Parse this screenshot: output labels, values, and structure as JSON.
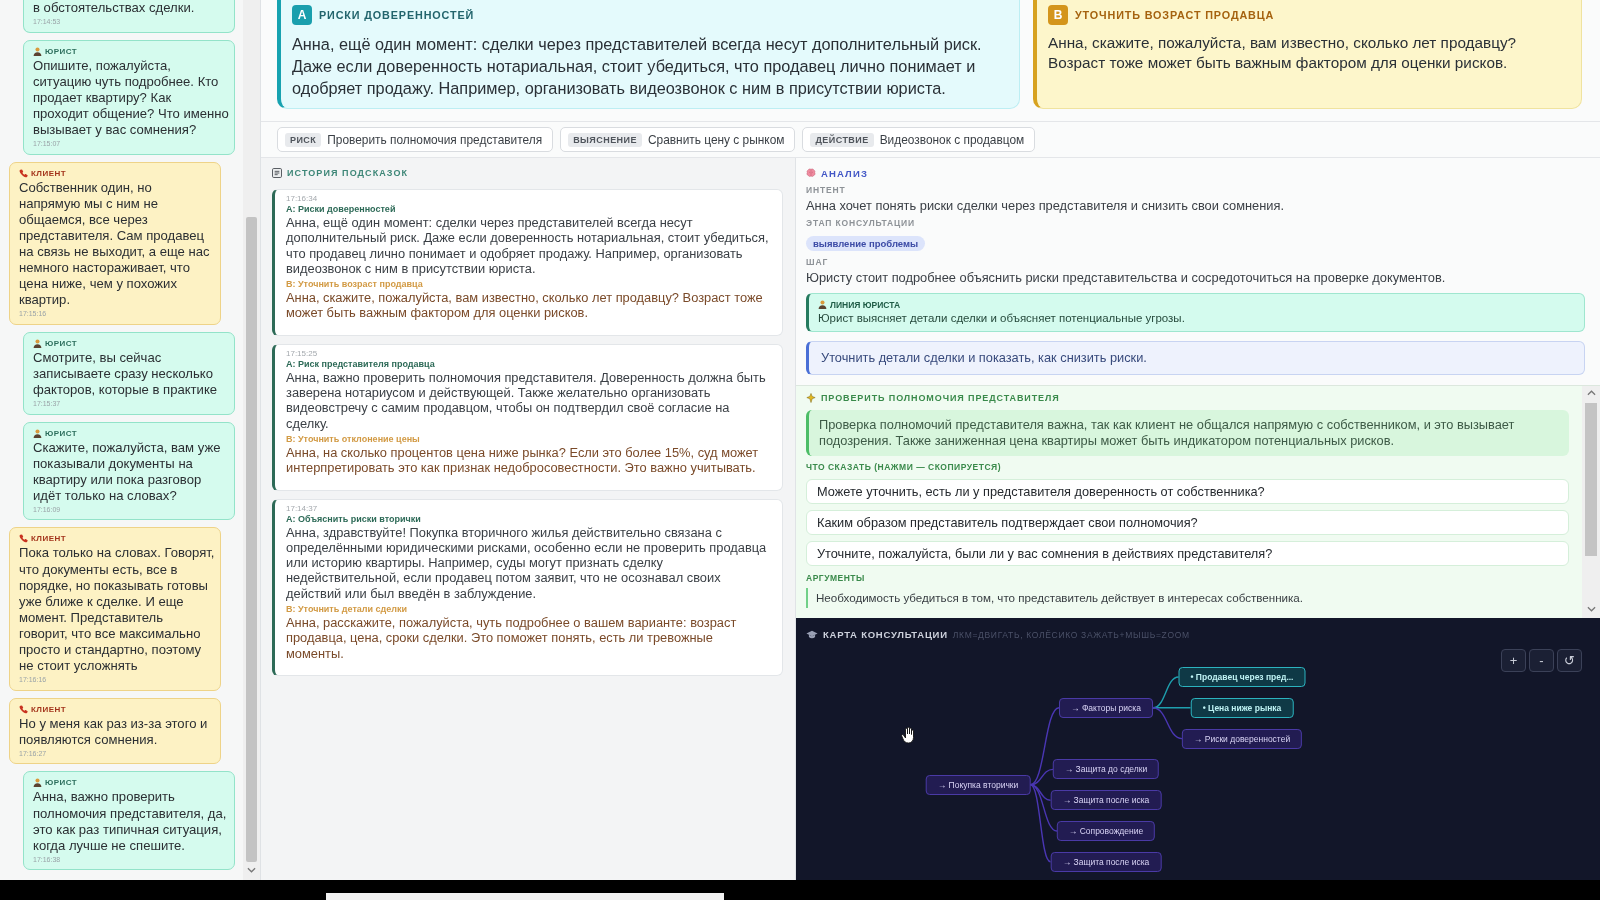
{
  "chat": {
    "messages": [
      {
        "kind": "lawyer",
        "text": "в обстоятельствах сделки.",
        "time": "17:14:53"
      },
      {
        "kind": "lawyer",
        "author": "ЮРИСТ",
        "text": "Опишите, пожалуйста, ситуацию чуть подробнее. Кто продает квартиру? Как проходит общение? Что именно вызывает у вас сомнения?",
        "time": "17:15:07"
      },
      {
        "kind": "client",
        "author": "КЛИЕНТ",
        "text": "Собственник один, но напрямую мы с ним не общаемся, все через представителя. Сам продавец на связь не выходит, а еще нас немного настораживает, что цена ниже, чем у похожих квартир.",
        "time": "17:15:16"
      },
      {
        "kind": "lawyer",
        "author": "ЮРИСТ",
        "text": "Смотрите, вы сейчас записываете сразу несколько факторов, которые в практике",
        "time": "17:15:37"
      },
      {
        "kind": "lawyer",
        "author": "ЮРИСТ",
        "text": "Скажите, пожалуйста, вам уже показывали документы на квартиру или пока разговор идёт только на словах?",
        "time": "17:16:09"
      },
      {
        "kind": "client",
        "author": "КЛИЕНТ",
        "text": "Пока только на словах. Говорят, что документы есть, все в порядке, но показывать готовы уже ближе к сделке. И еще момент. Представитель говорит, что все максимально просто и стандартно, поэтому не стоит усложнять",
        "time": "17:16:16"
      },
      {
        "kind": "client",
        "author": "КЛИЕНТ",
        "text": "Но у меня как раз из-за этого и появляются сомнения.",
        "time": "17:16:27"
      },
      {
        "kind": "lawyer",
        "author": "ЮРИСТ",
        "text": "Анна, важно проверить полномочия представителя, да, это как раз типичная ситуация, когда лучше не спешите.",
        "time": "17:16:38"
      }
    ]
  },
  "suggestions": [
    {
      "kind": "primary",
      "badge": "A",
      "title": "РИСКИ ДОВЕРЕННОСТЕЙ",
      "text": "Анна, ещё один момент: сделки через представителей всегда несут дополнительный риск. Даже если доверенность нотариальная, стоит убедиться, что продавец лично понимает и одобряет продажу. Например, организовать видеозвонок с ним в присутствии юриста."
    },
    {
      "kind": "secondary",
      "badge": "B",
      "title": "УТОЧНИТЬ ВОЗРАСТ ПРОДАВЦА",
      "text": "Анна, скажите, пожалуйста, вам известно, сколько лет продавцу? Возраст тоже может быть важным фактором для оценки рисков."
    }
  ],
  "quick_actions": [
    {
      "tag": "РИСК",
      "label": "Проверить полномочия представителя"
    },
    {
      "tag": "ВЫЯСНЕНИЕ",
      "label": "Сравнить цену с рынком"
    },
    {
      "tag": "ДЕЙСТВИЕ",
      "label": "Видеозвонок с продавцом"
    }
  ],
  "history": {
    "title": "ИСТОРИЯ ПОДСКАЗОК",
    "items": [
      {
        "time": "17:16:34",
        "a_title": "A: Риски доверенностей",
        "a_text": "Анна, ещё один момент: сделки через представителей всегда несут дополнительный риск. Даже если доверенность нотариальная, стоит убедиться, что продавец лично понимает и одобряет продажу. Например, организовать видеозвонок с ним в присутствии юриста.",
        "b_title": "B: Уточнить возраст продавца",
        "b_text": "Анна, скажите, пожалуйста, вам известно, сколько лет продавцу? Возраст тоже может быть важным фактором для оценки рисков."
      },
      {
        "time": "17:15:25",
        "a_title": "A: Риск представителя продавца",
        "a_text": "Анна, важно проверить полномочия представителя. Доверенность должна быть заверена нотариусом и действующей. Также желательно организовать видеовстречу с самим продавцом, чтобы он подтвердил своё согласие на сделку.",
        "b_title": "B: Уточнить отклонение цены",
        "b_text": "Анна, на сколько процентов цена ниже рынка? Если это более 15%, суд может интерпретировать это как признак недобросовестности. Это важно учитывать."
      },
      {
        "time": "17:14:37",
        "a_title": "A: Объяснить риски вторички",
        "a_text": "Анна, здравствуйте! Покупка вторичного жилья действительно связана с определёнными юридическими рисками, особенно если не проверить продавца или историю квартиры. Например, суды могут признать сделку недействительной, если продавец потом заявит, что не осознавал своих действий или был введён в заблуждение.",
        "b_title": "B: Уточнить детали сделки",
        "b_text": "Анна, расскажите, пожалуйста, чуть подробнее о вашем варианте: возраст продавца, цена, сроки сделки. Это поможет понять, есть ли тревожные моменты."
      }
    ]
  },
  "analysis": {
    "title": "АНАЛИЗ",
    "intent_label": "ИНТЕНТ",
    "intent": "Анна хочет понять риски сделки через представителя и снизить свои сомнения.",
    "stage_label": "ЭТАП КОНСУЛЬТАЦИИ",
    "stage": "выявление проблемы",
    "step_label": "ШАГ",
    "step": "Юристу стоит подробнее объяснить риски представительства и сосредоточиться на проверке документов.",
    "lawyer_line": {
      "label": "ЛИНИЯ ЮРИСТА",
      "text": "Юрист выясняет детали сделки и объясняет потенциальные угрозы."
    },
    "recommendation": "Уточнить детали сделки и показать, как снизить риски."
  },
  "check": {
    "title": "ПРОВЕРИТЬ ПОЛНОМОЧИЯ ПРЕДСТАВИТЕЛЯ",
    "note": "Проверка полномочий представителя важна, так как клиент не общался напрямую с собственником, и это вызывает подозрения. Также заниженная цена квартиры может быть индикатором потенциальных рисков.",
    "say_label": "ЧТО СКАЗАТЬ (НАЖМИ — СКОПИРУЕТСЯ)",
    "phrases": [
      "Можете уточнить, есть ли у представителя доверенность от собственника?",
      "Каким образом представитель подтверждает свои полномочия?",
      "Уточните, пожалуйста, были ли у вас сомнения в действиях представителя?"
    ],
    "arguments_label": "АРГУМЕНТЫ",
    "arguments": [
      "Необходимость убедиться в том, что представитель действует в интересах собственника."
    ]
  },
  "map": {
    "title": "КАРТА КОНСУЛЬТАЦИИ",
    "hint": "ЛКМ=ДВИГАТЬ, КОЛЁСИКО ЗАЖАТЬ+МЫШЬ=ZOOM",
    "controls": [
      "+",
      "-",
      "↺"
    ],
    "tree": {
      "label": "→ Покупка вторички",
      "active": false,
      "children": [
        {
          "label": "→ Факторы риска",
          "active": false,
          "children": [
            {
              "label": "• Продавец через пред...",
              "active": true
            },
            {
              "label": "• Цена ниже рынка",
              "active": true
            },
            {
              "label": "→ Риски доверенностей",
              "active": false
            }
          ]
        },
        {
          "label": "→ Защита до сделки",
          "active": false
        },
        {
          "label": "→ Защита после иска",
          "active": false
        },
        {
          "label": "→ Сопровождение",
          "active": false
        },
        {
          "label": "→ Защита после иска",
          "active": false
        }
      ]
    }
  }
}
